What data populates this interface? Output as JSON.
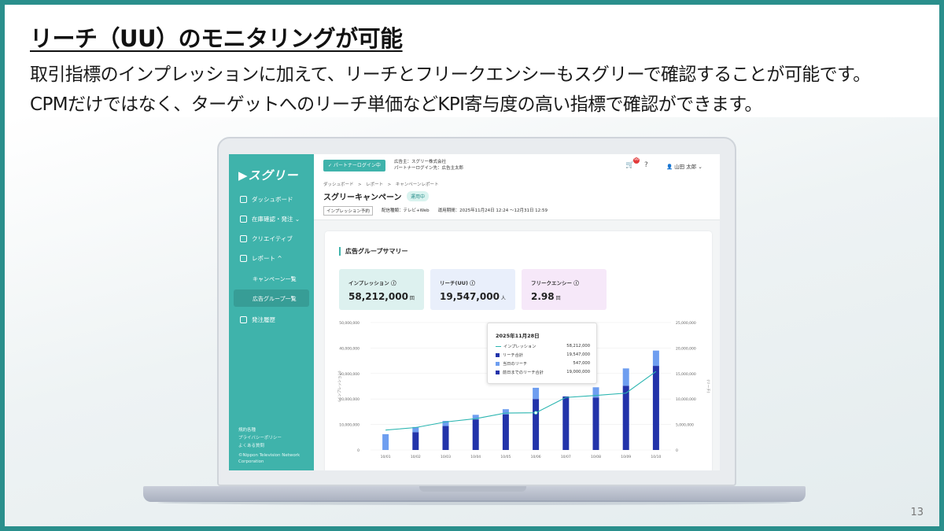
{
  "slide": {
    "title": "リーチ（UU）のモニタリングが可能",
    "body_line1": "取引指標のインプレッションに加えて、リーチとフリークエンシーもスグリーで確認することが可能です。",
    "body_line2": "CPMだけではなく、ターゲットへのリーチ単価などKPI寄与度の高い指標で確認ができます。",
    "page_number": "13"
  },
  "sidebar": {
    "logo": "▶スグリー",
    "items": [
      {
        "label": "ダッシュボード"
      },
      {
        "label": "在庫確認・発注 ⌄"
      },
      {
        "label": "クリエイティブ"
      },
      {
        "label": "レポート ^"
      },
      {
        "label": "発注履歴"
      }
    ],
    "sub_items": [
      {
        "label": "キャンペーン一覧"
      },
      {
        "label": "広告グループ一覧"
      }
    ],
    "footer": [
      "規約各種",
      "プライバシーポリシー",
      "よくある質問",
      "©Nippon Television Network",
      "Corporation"
    ]
  },
  "header": {
    "partner_badge": "✓ パートナーログイン中",
    "advertiser": "広告主：スグリー株式会社",
    "partner_login": "パートナーログイン先：広告主太郎",
    "cart_count": "99",
    "user_name": "山田 太郎",
    "breadcrumb": "ダッシュボード　>　レポート　>　キャンペーンレポート",
    "campaign_title": "スグリーキャンペーン",
    "status": "運用中",
    "tag": "インプレッション予約",
    "meta": "配信種類：テレビ+Web　　運用期間：2025年11月24日 12:24 〜12月31日 12:59"
  },
  "summary": {
    "title": "広告グループサマリー",
    "kpis": [
      {
        "label": "インプレッション ⓘ",
        "value": "58,212,000",
        "unit": "回",
        "color": "#ddf1ef"
      },
      {
        "label": "リーチ(UU) ⓘ",
        "value": "19,547,000",
        "unit": "人",
        "color": "#e9effb"
      },
      {
        "label": "フリークエンシー ⓘ",
        "value": "2.98",
        "unit": "回",
        "color": "#f6e8f9"
      }
    ]
  },
  "tooltip": {
    "date": "2025年11月28日",
    "rows": [
      {
        "label": "インプレッション",
        "value": "58,212,000",
        "kind": "line",
        "color": "#2ab5b0"
      },
      {
        "label": "リーチ合計",
        "value": "19,547,000",
        "kind": "bar",
        "color": "#2233aa"
      },
      {
        "label": "当日のリーチ",
        "value": "547,000",
        "kind": "bar",
        "color": "#6e9ef0"
      },
      {
        "label": "前日までのリーチ合計",
        "value": "19,000,000",
        "kind": "bar",
        "color": "#2233aa"
      }
    ]
  },
  "chart_data": {
    "type": "bar",
    "categories": [
      "10/01",
      "10/02",
      "10/03",
      "10/04",
      "10/05",
      "10/06",
      "10/07",
      "10/08",
      "10/09",
      "10/10"
    ],
    "series": [
      {
        "name": "前日までのリーチ合計",
        "axis": "right",
        "values": [
          0,
          3500000,
          4700000,
          6000000,
          7000000,
          10000000,
          10500000,
          10300000,
          12600000,
          16500000
        ],
        "color": "#2233aa"
      },
      {
        "name": "当日のリーチ",
        "axis": "right",
        "values": [
          3100000,
          1000000,
          1000000,
          900000,
          1000000,
          2200000,
          0,
          2000000,
          3400000,
          3000000
        ],
        "color": "#6e9ef0"
      },
      {
        "name": "インプレッション",
        "axis": "left",
        "type": "line",
        "values": [
          7800000,
          8800000,
          11000000,
          12300000,
          14500000,
          14600000,
          20600000,
          21400000,
          22300000,
          30800000
        ],
        "color": "#2ab5b0"
      }
    ],
    "y_left": {
      "ylim": [
        0,
        50000000
      ],
      "ticks": [
        "0",
        "10,000,000",
        "20,000,000",
        "30,000,000",
        "40,000,000",
        "50,000,000"
      ],
      "label": "インプレッション"
    },
    "y_right": {
      "ylim": [
        0,
        25000000
      ],
      "ticks": [
        "0",
        "5,000,000",
        "10,000,000",
        "15,000,000",
        "20,000,000",
        "25,000,000"
      ],
      "label": "リーチ"
    }
  }
}
